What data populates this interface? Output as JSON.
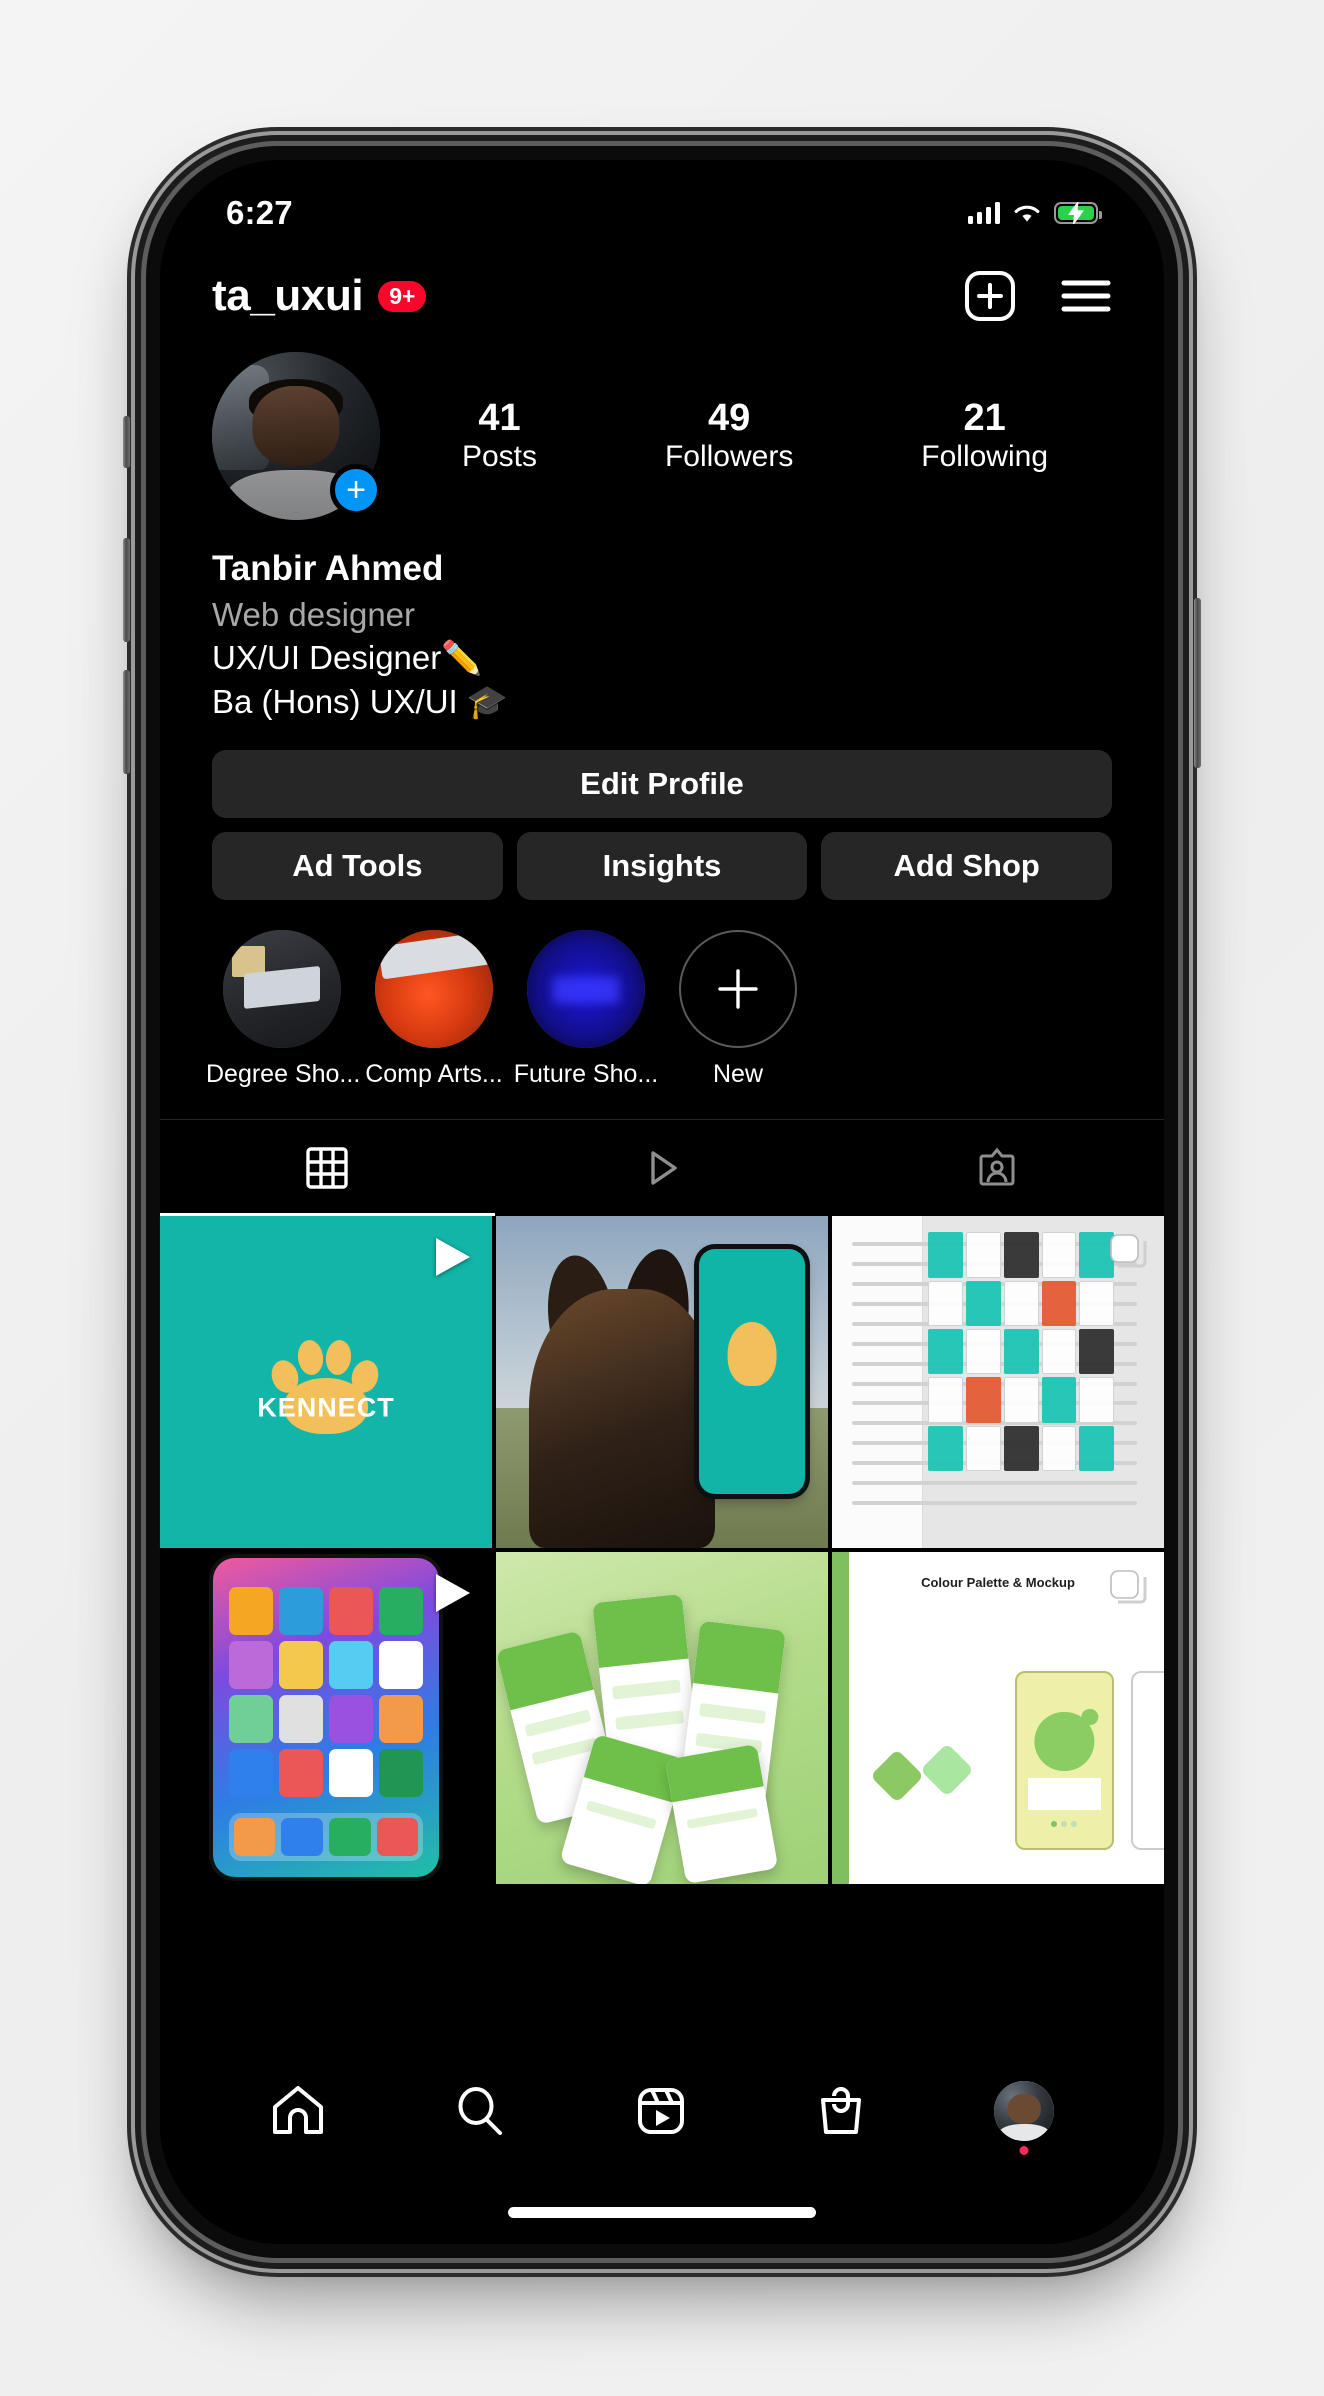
{
  "status_bar": {
    "time": "6:27",
    "cellular_icon": "signal-bars-icon",
    "wifi_icon": "wifi-icon",
    "battery_icon": "battery-charging-icon",
    "battery_charging": true,
    "battery_color": "#2ad24a"
  },
  "header": {
    "username": "ta_uxui",
    "notification_badge": "9+",
    "badge_color": "#f7082b",
    "create_icon": "plus-box-icon",
    "menu_icon": "hamburger-menu-icon"
  },
  "profile": {
    "avatar_name": "profile-avatar",
    "add_story_icon": "plus-icon",
    "add_story_color": "#0095f6",
    "stats": [
      {
        "value": "41",
        "label": "Posts"
      },
      {
        "value": "49",
        "label": "Followers"
      },
      {
        "value": "21",
        "label": "Following"
      }
    ],
    "display_name": "Tanbir Ahmed",
    "category": "Web designer",
    "bio_lines": [
      "UX/UI Designer✏️",
      "Ba (Hons) UX/UI 🎓"
    ]
  },
  "actions": {
    "edit_profile": "Edit Profile",
    "ad_tools": "Ad Tools",
    "insights": "Insights",
    "add_shop": "Add Shop"
  },
  "highlights": [
    {
      "label": "Degree Sho...",
      "name": "highlight-degree-show"
    },
    {
      "label": "Comp Arts...",
      "name": "highlight-comp-arts"
    },
    {
      "label": "Future Sho...",
      "name": "highlight-future-show"
    },
    {
      "label": "New",
      "name": "highlight-new"
    }
  ],
  "tabs": [
    {
      "icon": "grid-icon",
      "name": "tab-grid",
      "active": true
    },
    {
      "icon": "reels-play-icon",
      "name": "tab-reels",
      "active": false
    },
    {
      "icon": "tagged-person-icon",
      "name": "tab-tagged",
      "active": false
    }
  ],
  "grid_posts": [
    {
      "name": "post-kennect-video",
      "overlay_icon": "play-icon",
      "caption": "KENNECT",
      "bg_color": "#12b5a8",
      "logo": "paw-logo"
    },
    {
      "name": "post-dog-mockup",
      "overlay_icon": "none",
      "caption": ""
    },
    {
      "name": "post-figma-board",
      "overlay_icon": "carousel-icon",
      "caption": ""
    },
    {
      "name": "post-iphone-home-video",
      "overlay_icon": "play-icon",
      "caption": ""
    },
    {
      "name": "post-green-phone-mockups",
      "overlay_icon": "none",
      "caption": ""
    },
    {
      "name": "post-colour-palette",
      "overlay_icon": "carousel-icon",
      "caption": "Colour Palette & Mockup"
    }
  ],
  "bottom_nav": [
    {
      "name": "nav-home",
      "icon": "home-icon"
    },
    {
      "name": "nav-search",
      "icon": "search-icon"
    },
    {
      "name": "nav-reels",
      "icon": "reels-icon"
    },
    {
      "name": "nav-shop",
      "icon": "shopping-bag-icon"
    },
    {
      "name": "nav-profile",
      "icon": "profile-avatar-icon",
      "has_dot": true
    }
  ]
}
